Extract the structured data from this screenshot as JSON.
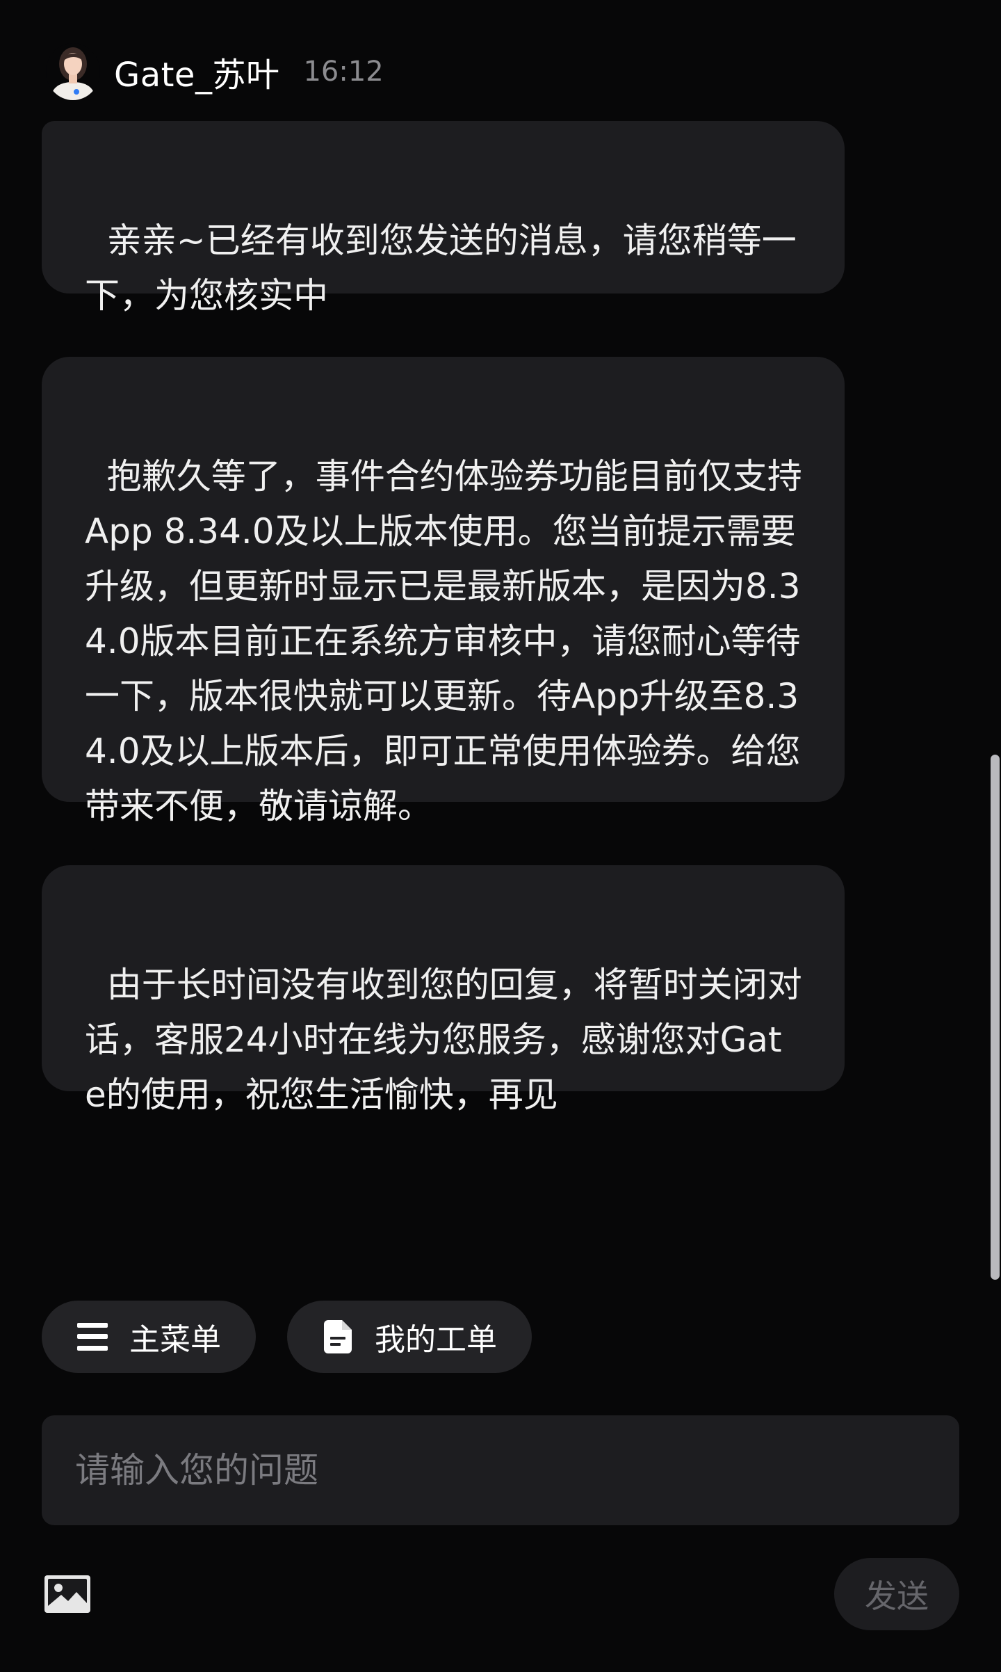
{
  "header": {
    "agent_name": "Gate_苏叶",
    "time": "16:12"
  },
  "messages": [
    {
      "text": "亲亲~已经有收到您发送的消息，请您稍等一下，为您核实中"
    },
    {
      "text": "抱歉久等了，事件合约体验券功能目前仅支持App 8.34.0及以上版本使用。您当前提示需要升级，但更新时显示已是最新版本，是因为8.34.0版本目前正在系统方审核中，请您耐心等待一下，版本很快就可以更新。待App升级至8.34.0及以上版本后，即可正常使用体验券。给您带来不便，敬请谅解。"
    },
    {
      "text": "由于长时间没有收到您的回复，将暂时关闭对话，客服24小时在线为您服务，感谢您对Gate的使用，祝您生活愉快，再见"
    }
  ],
  "quick_menu": {
    "main_menu_label": "主菜单",
    "main_menu_icon": "menu-icon",
    "my_tickets_label": "我的工单",
    "my_tickets_icon": "document-icon"
  },
  "composer": {
    "placeholder": "请输入您的问题",
    "value": "",
    "image_icon": "image-icon",
    "send_label": "发送"
  },
  "colors": {
    "background": "#070708",
    "bubble": "#1d1d20",
    "chip": "#232326",
    "muted_text": "#8c8c90",
    "send_disabled_text": "#66666b"
  }
}
